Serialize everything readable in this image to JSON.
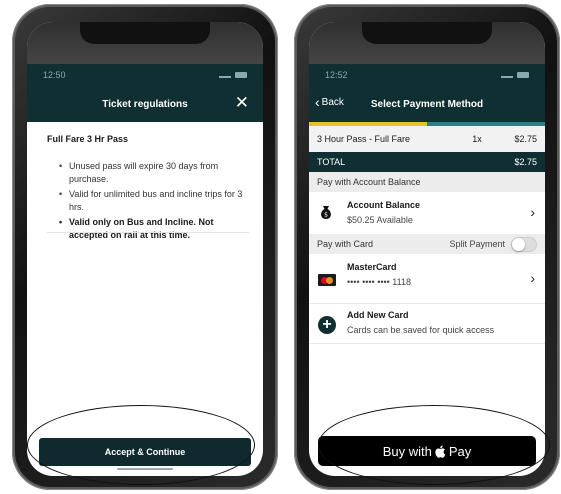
{
  "left_phone": {
    "status_time": "12:50",
    "header_title": "Ticket regulations",
    "close_icon": "✕",
    "pass_title": "Full Fare 3 Hr Pass",
    "rules": [
      "Unused pass will expire 30 days from purchase.",
      "Valid for unlimited bus and incline trips for 3 hrs.",
      "Valid only on Bus and Incline. Not accepted on rail at this time."
    ],
    "accept_label": "Accept & Continue"
  },
  "right_phone": {
    "status_time": "12:52",
    "back_label": "Back",
    "header_title": "Select Payment Method",
    "progress": 0.5,
    "order_item": {
      "name": "3 Hour Pass - Full Fare",
      "qty": "1x",
      "price": "$2.75"
    },
    "total": {
      "label": "TOTAL",
      "price": "$2.75"
    },
    "section_account": "Pay with Account Balance",
    "account_balance": {
      "title": "Account Balance",
      "subtitle": "$50.25 Available"
    },
    "section_card": "Pay with Card",
    "split_payment_label": "Split Payment",
    "split_payment_on": false,
    "mastercard": {
      "title": "MasterCard",
      "number": "•••• •••• •••• 1118"
    },
    "add_card": {
      "title": "Add New Card",
      "subtitle": "Cards can be saved for quick access"
    },
    "apple_pay_prefix": "Buy with",
    "apple_pay_suffix": "Pay"
  },
  "colors": {
    "header": "#102f33",
    "accent_yellow": "#e6c229",
    "accent_teal": "#2d7d84"
  },
  "icons": [
    "close-icon",
    "back-chevron-icon",
    "money-bag-icon",
    "mastercard-icon",
    "plus-icon",
    "chevron-right-icon",
    "apple-logo-icon"
  ]
}
